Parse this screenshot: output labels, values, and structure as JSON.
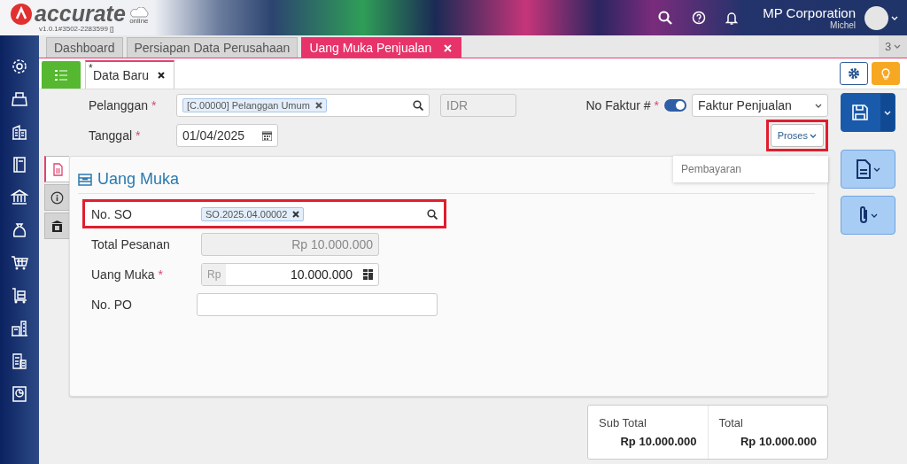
{
  "header": {
    "logo_text": "accurate",
    "logo_badge": "online",
    "version": "v1.0.1#3502-2283599 []",
    "company": "MP Corporation",
    "user": "Michel"
  },
  "tabs": [
    {
      "label": "Dashboard",
      "selected": false,
      "closable": false
    },
    {
      "label": "Persiapan Data Perusahaan",
      "selected": false,
      "closable": false
    },
    {
      "label": "Uang Muka Penjualan",
      "selected": true,
      "closable": true
    }
  ],
  "tab_overflow": {
    "count": "3"
  },
  "subtabs": [
    {
      "label": "Data Baru",
      "modified_mark": "*",
      "selected": true
    }
  ],
  "header_fields": {
    "pelanggan": {
      "label": "Pelanggan",
      "required_mark": "*",
      "chip": "[C.00000] Pelanggan Umum"
    },
    "currency": {
      "value": "IDR"
    },
    "tanggal": {
      "label": "Tanggal",
      "required_mark": "*",
      "value": "01/04/2025"
    },
    "no_faktur": {
      "label": "No Faktur #",
      "required_mark": "*",
      "auto_number": true,
      "value": "Faktur Penjualan"
    },
    "proses": {
      "label": "Proses",
      "highlighted": true,
      "menu": [
        "Pembayaran"
      ]
    }
  },
  "side_tabs": [
    {
      "kind": "document",
      "selected": true
    },
    {
      "kind": "info",
      "selected": false
    },
    {
      "kind": "bank",
      "selected": false
    }
  ],
  "section": {
    "title": "Uang Muka",
    "fields": [
      {
        "kind": "chip",
        "label": "No. SO",
        "value": "SO.2025.04.00002",
        "highlighted": true
      },
      {
        "kind": "readonly",
        "label": "Total Pesanan",
        "value": "Rp 10.000.000",
        "highlighted": false
      },
      {
        "kind": "currency",
        "label": "Uang Muka",
        "required_mark": "*",
        "prefix": "Rp",
        "value": "10.000.000",
        "highlighted": false
      },
      {
        "kind": "text",
        "label": "No. PO",
        "highlighted": false
      }
    ]
  },
  "totals": [
    {
      "label": "Sub Total",
      "value": "Rp 10.000.000"
    },
    {
      "label": "Total",
      "value": "Rp 10.000.000"
    }
  ]
}
